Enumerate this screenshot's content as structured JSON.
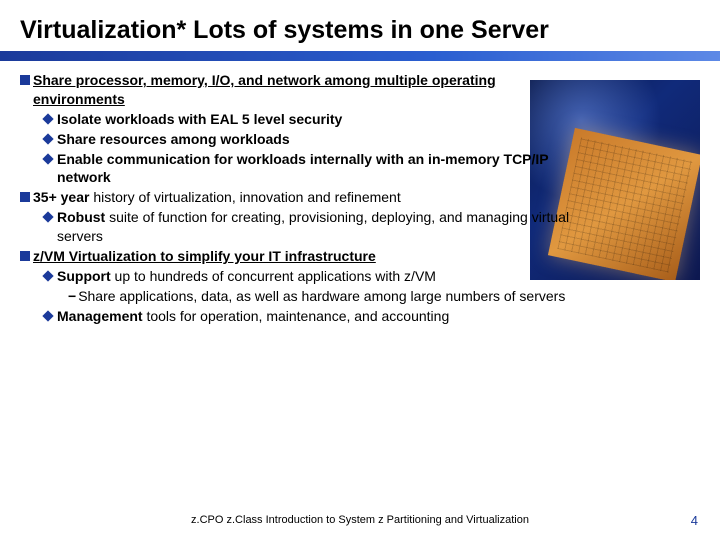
{
  "title": "Virtualization* Lots of systems in one Server",
  "b1": "Share processor, memory, I/O, and network among multiple operating environments",
  "b1a": "Isolate workloads with EAL 5 level security",
  "b1b": "Share resources among workloads",
  "b1c": "Enable communication for workloads internally with an in-memory TCP/IP network",
  "b2a": "35+ year",
  "b2b": " history of virtualization, innovation and refinement",
  "b2_1a": "Robust",
  "b2_1b": " suite of function for creating, provisioning, deploying, and managing virtual servers",
  "b3": "z/VM Virtualization to simplify your IT infrastructure",
  "b3_1a": "Support",
  "b3_1b": " up to hundreds of concurrent applications with z/VM",
  "b3_1_1": "Share applications, data, as well as hardware among large numbers of servers",
  "b3_2a": "Management",
  "b3_2b": " tools for operation, maintenance, and accounting",
  "footer": "z.CPO z.Class  Introduction to System z Partitioning and Virtualization",
  "page": "4"
}
